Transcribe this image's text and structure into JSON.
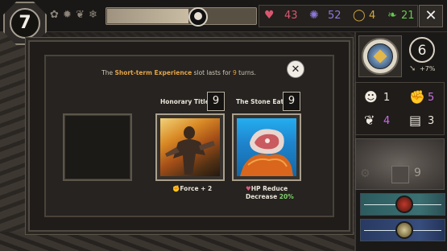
{
  "top_bar": {
    "turn_number": "7",
    "state_icons": [
      "flower-icon",
      "sun-icon",
      "lotus-icon",
      "snowflake-icon"
    ],
    "progress_fraction": 0.55,
    "resources": [
      {
        "icon": "heart-icon",
        "value": "43",
        "color": "#d9566e"
      },
      {
        "icon": "gem-icon",
        "value": "52",
        "color": "#8d78d8"
      },
      {
        "icon": "ring-icon",
        "value": "4",
        "color": "#d4a93b"
      },
      {
        "icon": "apple-icon",
        "value": "21",
        "color": "#63c94d"
      }
    ]
  },
  "dialog": {
    "message_pre": "The ",
    "message_highlight": "Short-term Experience",
    "message_mid": " slot lasts for ",
    "message_turns": "9",
    "message_post": " turns.",
    "cards": [
      {
        "name": "Honorary Titles",
        "count": "9",
        "desc_line1": "Force + 2",
        "desc_icon": "fist-icon"
      },
      {
        "name": "The Stone Eater",
        "count": "9",
        "desc_line1": "HP Reduce",
        "desc_line2_pre": "Decrease ",
        "desc_line2_value": "20%",
        "desc_icon": "heart-icon"
      }
    ]
  },
  "side_panel": {
    "turns_left": "6",
    "turns_rate": "+7%",
    "stats": [
      {
        "icon": "head-icon",
        "value": "1",
        "color": "#e9e3d8"
      },
      {
        "icon": "fist-icon",
        "value": "5",
        "color": "#c96fe0"
      },
      {
        "icon": "feather-icon",
        "value": "4",
        "color": "#c96fe0"
      },
      {
        "icon": "book-icon",
        "value": "3",
        "color": "#e9e3d8"
      }
    ],
    "skill_count": "9"
  }
}
